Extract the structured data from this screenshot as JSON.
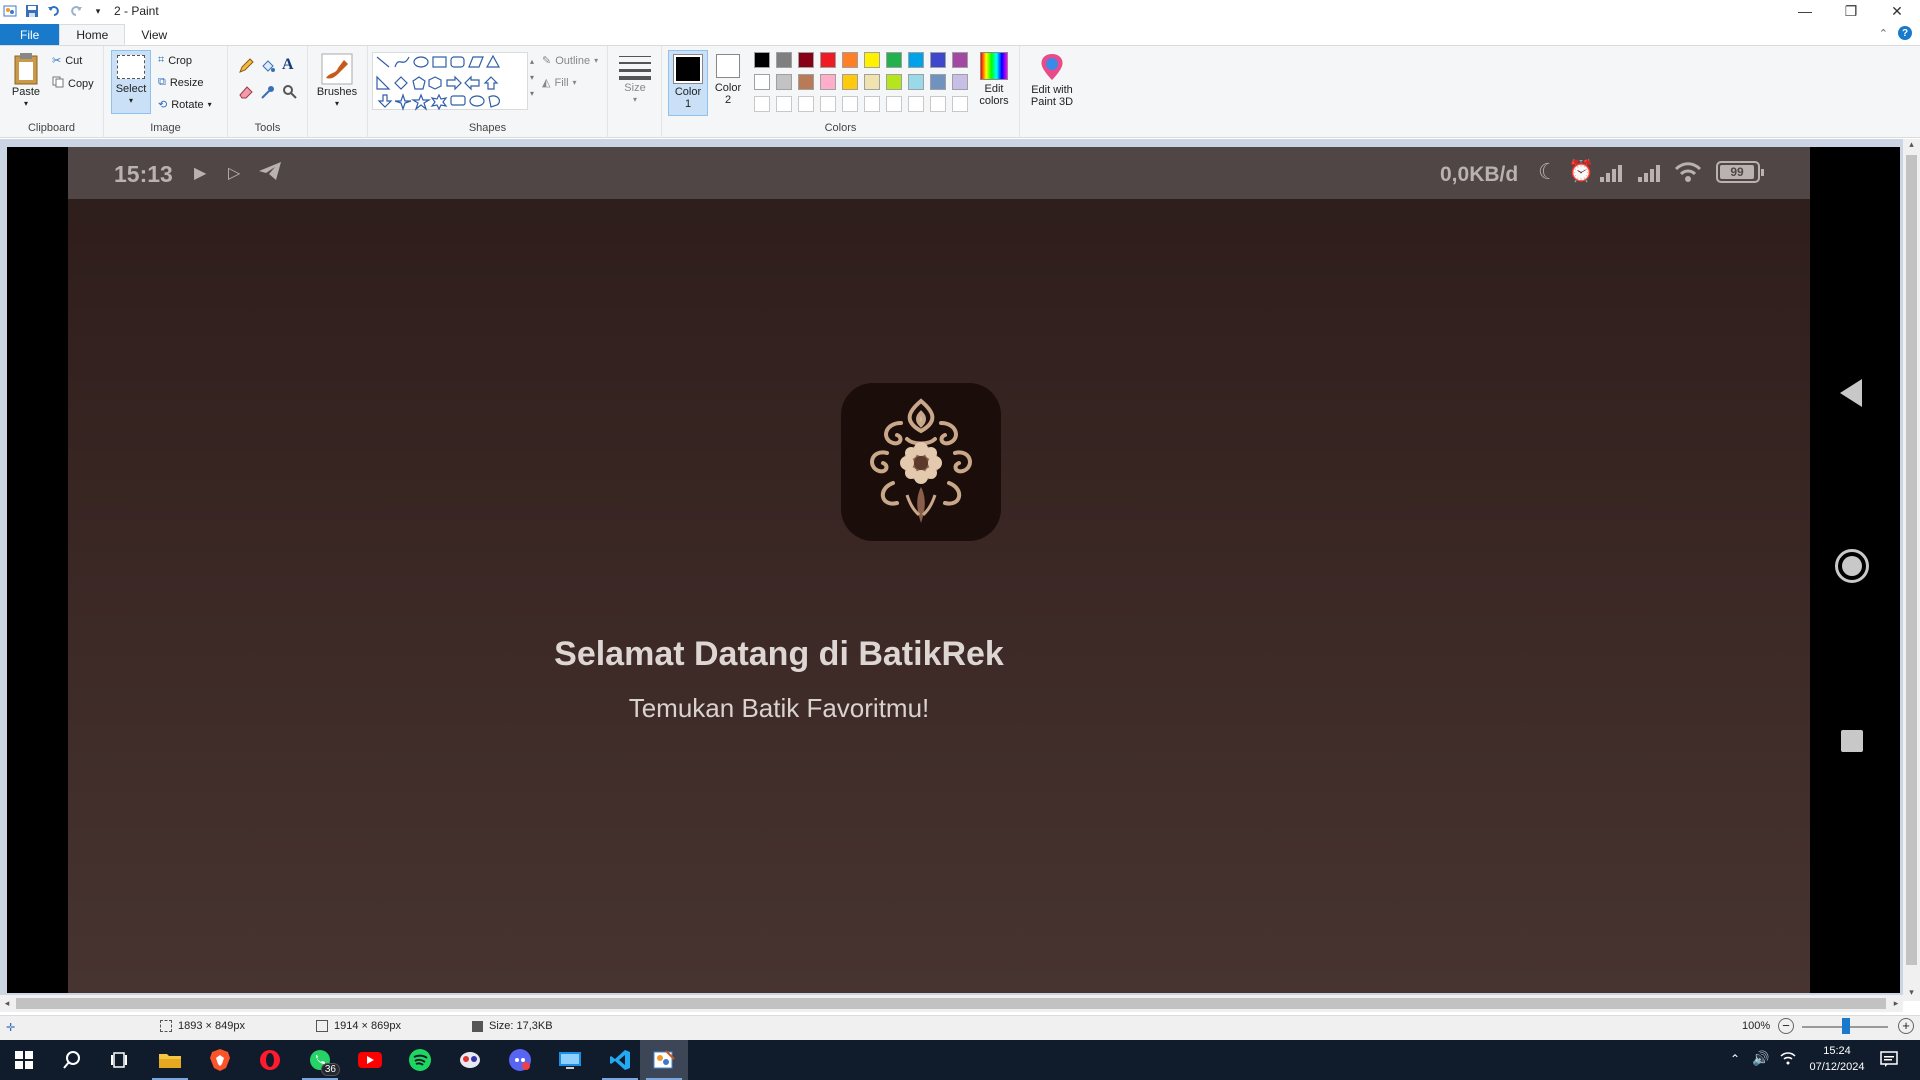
{
  "window": {
    "title": "2 - Paint",
    "controls": {
      "minimize": "—",
      "maximize": "❐",
      "close": "✕"
    }
  },
  "menu": {
    "tabs": [
      {
        "label": "File"
      },
      {
        "label": "Home"
      },
      {
        "label": "View"
      }
    ]
  },
  "ribbon": {
    "clipboard": {
      "paste": "Paste",
      "cut": "Cut",
      "copy": "Copy",
      "label": "Clipboard"
    },
    "image": {
      "select": "Select",
      "crop": "Crop",
      "resize": "Resize",
      "rotate": "Rotate",
      "label": "Image"
    },
    "tools": {
      "label": "Tools"
    },
    "brushes": {
      "label": "Brushes"
    },
    "shapes": {
      "outline": "Outline",
      "fill": "Fill",
      "label": "Shapes"
    },
    "size": {
      "label": "Size"
    },
    "colors": {
      "color1": "Color 1",
      "color2": "Color 2",
      "edit": "Edit colors",
      "label": "Colors",
      "palette_row1": [
        "#000000",
        "#7f7f7f",
        "#880015",
        "#ed1c24",
        "#ff7f27",
        "#fff200",
        "#22b14c",
        "#00a2e8",
        "#3f48cc",
        "#a349a4"
      ],
      "palette_row2": [
        "#ffffff",
        "#c3c3c3",
        "#b97a57",
        "#ffaec9",
        "#ffc90e",
        "#efe4b0",
        "#b5e61d",
        "#99d9ea",
        "#7092be",
        "#c8bfe7"
      ]
    },
    "paint3d": {
      "label": "Edit with Paint 3D"
    }
  },
  "phone": {
    "status": {
      "time": "15:13",
      "speed": "0,0KB/d",
      "battery": "99"
    },
    "welcome_title": "Selamat Datang di BatikRek",
    "welcome_subtitle": "Temukan Batik Favoritmu!"
  },
  "statusbar": {
    "selection_size": "1893 × 849px",
    "image_size": "1914 × 869px",
    "file_size": "Size: 17,3KB",
    "zoom": "100%"
  },
  "taskbar": {
    "clock_time": "15:24",
    "clock_date": "07/12/2024",
    "whatsapp_badge": "36"
  }
}
